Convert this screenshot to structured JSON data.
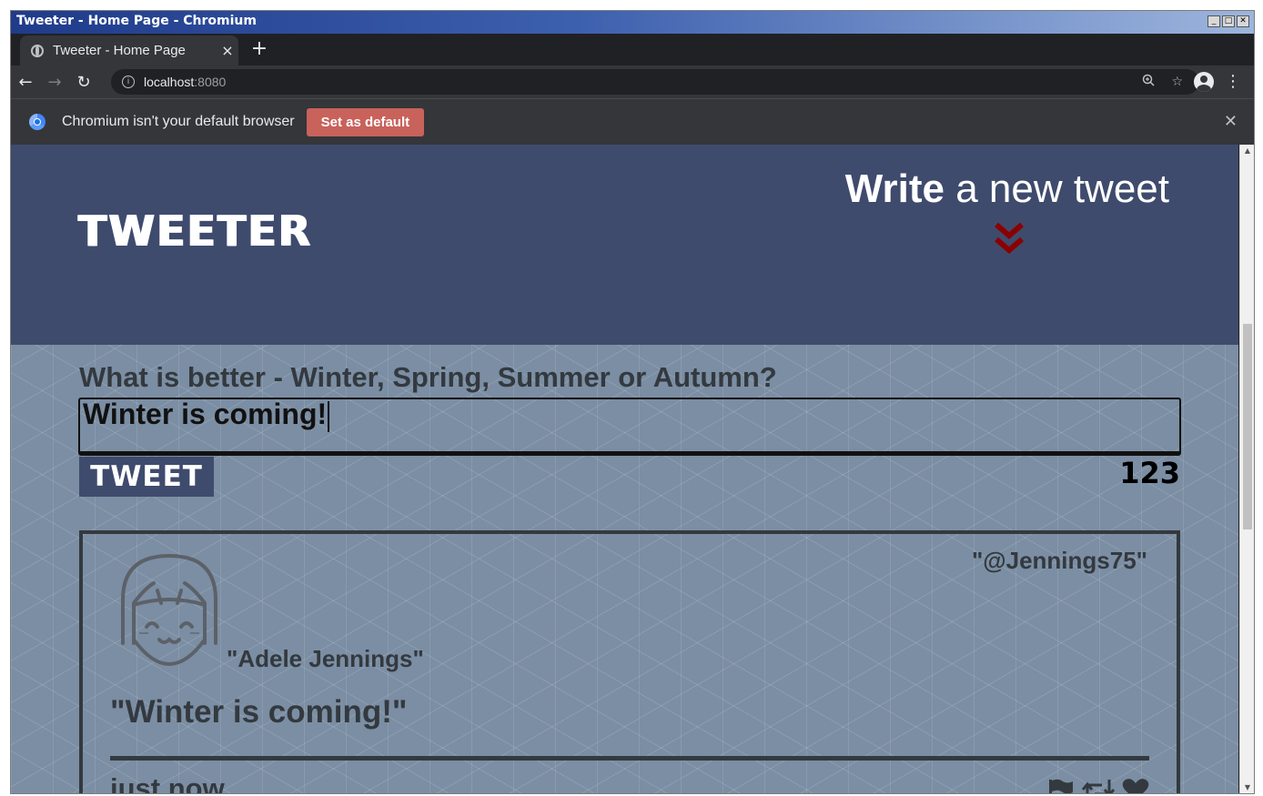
{
  "window": {
    "title": "Tweeter - Home Page - Chromium",
    "controls": [
      "_",
      "□",
      "✕"
    ]
  },
  "browser": {
    "tab_title": "Tweeter - Home Page",
    "tab_close": "×",
    "new_tab": "+",
    "url_host": "localhost",
    "url_port": ":8080",
    "infobar_text": "Chromium isn't your default browser",
    "set_default_label": "Set as default",
    "infobar_close": "✕",
    "nav": {
      "back": "←",
      "forward": "→",
      "reload": "↻"
    },
    "icons": {
      "zoom": "zoom-icon",
      "star": "star-icon",
      "profile": "profile-icon",
      "menu": "menu-icon"
    }
  },
  "header": {
    "logo": "TWEETER",
    "write_bold": "Write",
    "write_rest": " a new tweet"
  },
  "composer": {
    "question": "What is better - Winter, Spring, Summer or Autumn?",
    "value": "Winter is coming!",
    "tweet_button": "TWEET",
    "counter": "123"
  },
  "tweet": {
    "handle": "\"@Jennings75\"",
    "name": "\"Adele Jennings\"",
    "content": "\"Winter is coming!\"",
    "time": "just now",
    "actions": [
      "flag-icon",
      "retweet-icon",
      "heart-icon"
    ]
  },
  "colors": {
    "header_bg": "#3f4b6d",
    "main_bg": "#7b8ea3",
    "text_dark": "#33393f",
    "accent_red": "#8b0000",
    "set_default_bg": "#c8625b"
  }
}
